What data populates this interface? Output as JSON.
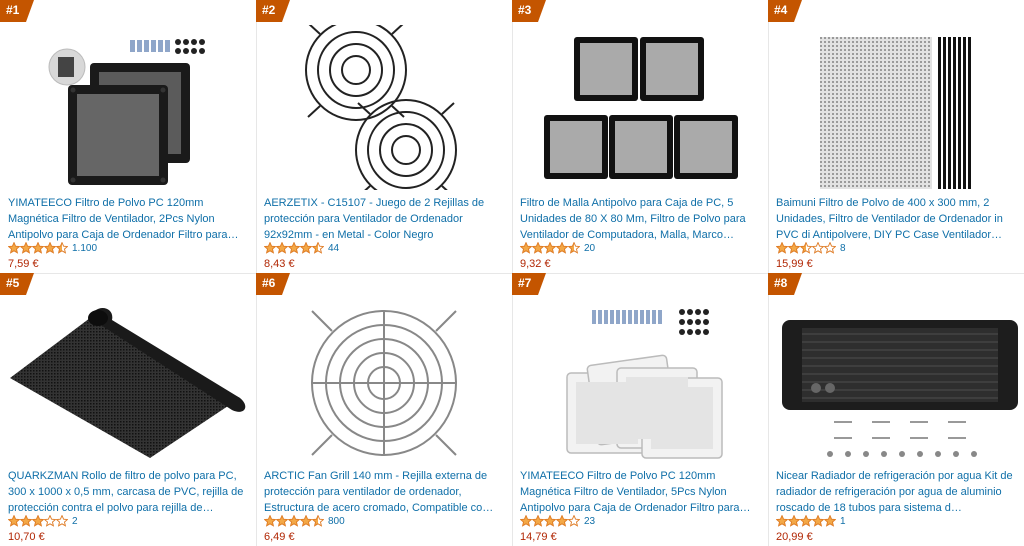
{
  "products": [
    {
      "rank": "#1",
      "title": "YIMATEECO Filtro de Polvo PC 120mm Magnética Filtro de Ventilador, 2Pcs Nylon Antipolvo para Caja de Ordenador Filtro para…",
      "stars": 4.5,
      "count": "1.100",
      "price": "7,59 €"
    },
    {
      "rank": "#2",
      "title": "AERZETIX - C15107 - Juego de 2 Rejillas de protección para Ventilador de Ordenador 92x92mm - en Metal - Color Negro",
      "stars": 4.5,
      "count": "44",
      "price": "8,43 €"
    },
    {
      "rank": "#3",
      "title": "Filtro de Malla Antipolvo para Caja de PC, 5 Unidades de 80 X 80 Mm, Filtro de Polvo para Ventilador de Computadora, Malla, Marco…",
      "stars": 4.5,
      "count": "20",
      "price": "9,32 €"
    },
    {
      "rank": "#4",
      "title": "Baimuni Filtro de Polvo de 400 x 300 mm, 2 Unidades, Filtro de Ventilador de Ordenador in PVC di Antipolvere, DIY PC Case Ventilador…",
      "stars": 2.5,
      "count": "8",
      "price": "15,99 €"
    },
    {
      "rank": "#5",
      "title": "QUARKZMAN Rollo de filtro de polvo para PC, 300 x 1000 x 0,5 mm, carcasa de PVC, rejilla de protección contra el polvo para rejilla de…",
      "stars": 3,
      "count": "2",
      "price": "10,70 €"
    },
    {
      "rank": "#6",
      "title": "ARCTIC Fan Grill 140 mm - Rejilla externa de protección para ventilador de ordenador, Estructura de acero cromado, Compatible co…",
      "stars": 4.5,
      "count": "800",
      "price": "6,49 €"
    },
    {
      "rank": "#7",
      "title": "YIMATEECO Filtro de Polvo PC 120mm Magnética Filtro de Ventilador, 5Pcs Nylon Antipolvo para Caja de Ordenador Filtro para…",
      "stars": 4,
      "count": "23",
      "price": "14,79 €"
    },
    {
      "rank": "#8",
      "title": "Nicear Radiador de refrigeración por agua Kit de radiador de refrigeración por agua de aluminio roscado de 18 tubos para sistema d…",
      "stars": 5,
      "count": "1",
      "price": "20,99 €"
    }
  ],
  "colors": {
    "badge": "#c45500",
    "link": "#0f6fa8",
    "price": "#b12704",
    "star": "#f3a847",
    "star_outline": "#de7921"
  }
}
